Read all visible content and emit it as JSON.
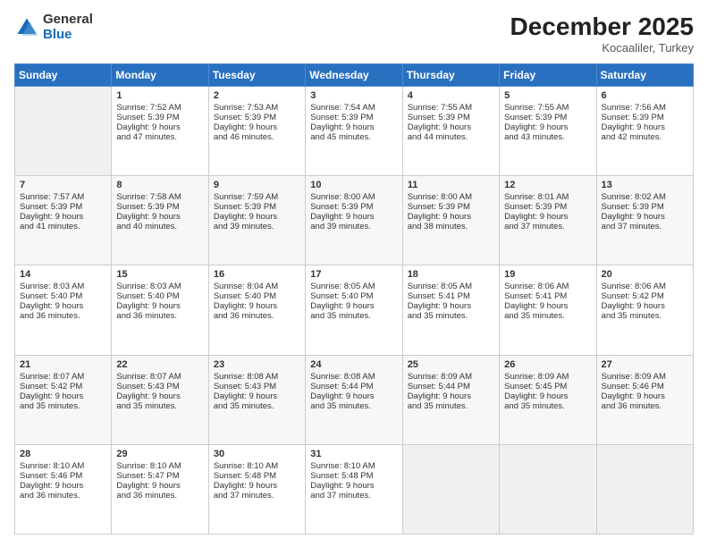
{
  "logo": {
    "general": "General",
    "blue": "Blue"
  },
  "header": {
    "month": "December 2025",
    "location": "Kocaaliler, Turkey"
  },
  "days": [
    "Sunday",
    "Monday",
    "Tuesday",
    "Wednesday",
    "Thursday",
    "Friday",
    "Saturday"
  ],
  "weeks": [
    [
      {
        "day": "",
        "content": ""
      },
      {
        "day": "1",
        "content": "Sunrise: 7:52 AM\nSunset: 5:39 PM\nDaylight: 9 hours\nand 47 minutes."
      },
      {
        "day": "2",
        "content": "Sunrise: 7:53 AM\nSunset: 5:39 PM\nDaylight: 9 hours\nand 46 minutes."
      },
      {
        "day": "3",
        "content": "Sunrise: 7:54 AM\nSunset: 5:39 PM\nDaylight: 9 hours\nand 45 minutes."
      },
      {
        "day": "4",
        "content": "Sunrise: 7:55 AM\nSunset: 5:39 PM\nDaylight: 9 hours\nand 44 minutes."
      },
      {
        "day": "5",
        "content": "Sunrise: 7:55 AM\nSunset: 5:39 PM\nDaylight: 9 hours\nand 43 minutes."
      },
      {
        "day": "6",
        "content": "Sunrise: 7:56 AM\nSunset: 5:39 PM\nDaylight: 9 hours\nand 42 minutes."
      }
    ],
    [
      {
        "day": "7",
        "content": "Sunrise: 7:57 AM\nSunset: 5:39 PM\nDaylight: 9 hours\nand 41 minutes."
      },
      {
        "day": "8",
        "content": "Sunrise: 7:58 AM\nSunset: 5:39 PM\nDaylight: 9 hours\nand 40 minutes."
      },
      {
        "day": "9",
        "content": "Sunrise: 7:59 AM\nSunset: 5:39 PM\nDaylight: 9 hours\nand 39 minutes."
      },
      {
        "day": "10",
        "content": "Sunrise: 8:00 AM\nSunset: 5:39 PM\nDaylight: 9 hours\nand 39 minutes."
      },
      {
        "day": "11",
        "content": "Sunrise: 8:00 AM\nSunset: 5:39 PM\nDaylight: 9 hours\nand 38 minutes."
      },
      {
        "day": "12",
        "content": "Sunrise: 8:01 AM\nSunset: 5:39 PM\nDaylight: 9 hours\nand 37 minutes."
      },
      {
        "day": "13",
        "content": "Sunrise: 8:02 AM\nSunset: 5:39 PM\nDaylight: 9 hours\nand 37 minutes."
      }
    ],
    [
      {
        "day": "14",
        "content": "Sunrise: 8:03 AM\nSunset: 5:40 PM\nDaylight: 9 hours\nand 36 minutes."
      },
      {
        "day": "15",
        "content": "Sunrise: 8:03 AM\nSunset: 5:40 PM\nDaylight: 9 hours\nand 36 minutes."
      },
      {
        "day": "16",
        "content": "Sunrise: 8:04 AM\nSunset: 5:40 PM\nDaylight: 9 hours\nand 36 minutes."
      },
      {
        "day": "17",
        "content": "Sunrise: 8:05 AM\nSunset: 5:40 PM\nDaylight: 9 hours\nand 35 minutes."
      },
      {
        "day": "18",
        "content": "Sunrise: 8:05 AM\nSunset: 5:41 PM\nDaylight: 9 hours\nand 35 minutes."
      },
      {
        "day": "19",
        "content": "Sunrise: 8:06 AM\nSunset: 5:41 PM\nDaylight: 9 hours\nand 35 minutes."
      },
      {
        "day": "20",
        "content": "Sunrise: 8:06 AM\nSunset: 5:42 PM\nDaylight: 9 hours\nand 35 minutes."
      }
    ],
    [
      {
        "day": "21",
        "content": "Sunrise: 8:07 AM\nSunset: 5:42 PM\nDaylight: 9 hours\nand 35 minutes."
      },
      {
        "day": "22",
        "content": "Sunrise: 8:07 AM\nSunset: 5:43 PM\nDaylight: 9 hours\nand 35 minutes."
      },
      {
        "day": "23",
        "content": "Sunrise: 8:08 AM\nSunset: 5:43 PM\nDaylight: 9 hours\nand 35 minutes."
      },
      {
        "day": "24",
        "content": "Sunrise: 8:08 AM\nSunset: 5:44 PM\nDaylight: 9 hours\nand 35 minutes."
      },
      {
        "day": "25",
        "content": "Sunrise: 8:09 AM\nSunset: 5:44 PM\nDaylight: 9 hours\nand 35 minutes."
      },
      {
        "day": "26",
        "content": "Sunrise: 8:09 AM\nSunset: 5:45 PM\nDaylight: 9 hours\nand 35 minutes."
      },
      {
        "day": "27",
        "content": "Sunrise: 8:09 AM\nSunset: 5:46 PM\nDaylight: 9 hours\nand 36 minutes."
      }
    ],
    [
      {
        "day": "28",
        "content": "Sunrise: 8:10 AM\nSunset: 5:46 PM\nDaylight: 9 hours\nand 36 minutes."
      },
      {
        "day": "29",
        "content": "Sunrise: 8:10 AM\nSunset: 5:47 PM\nDaylight: 9 hours\nand 36 minutes."
      },
      {
        "day": "30",
        "content": "Sunrise: 8:10 AM\nSunset: 5:48 PM\nDaylight: 9 hours\nand 37 minutes."
      },
      {
        "day": "31",
        "content": "Sunrise: 8:10 AM\nSunset: 5:48 PM\nDaylight: 9 hours\nand 37 minutes."
      },
      {
        "day": "",
        "content": ""
      },
      {
        "day": "",
        "content": ""
      },
      {
        "day": "",
        "content": ""
      }
    ]
  ]
}
